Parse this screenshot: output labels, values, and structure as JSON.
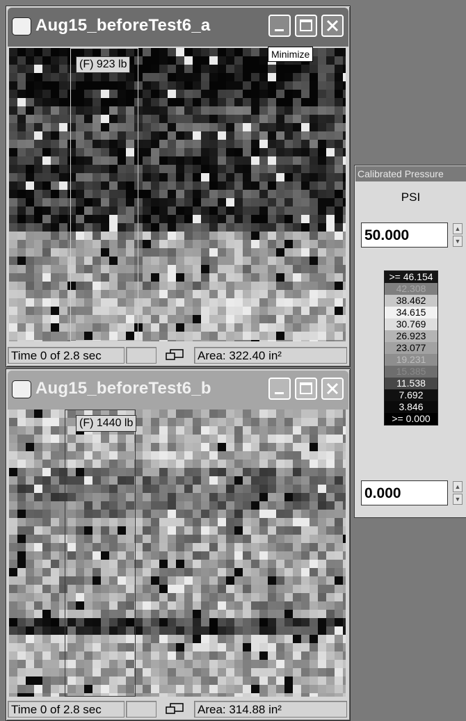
{
  "window_a": {
    "title": "Aug15_beforeTest6_a",
    "tooltip": "Minimize",
    "force_label": "(F) 923 lb",
    "status": {
      "time": "Time 0 of 2.8 sec",
      "area": "Area: 322.40 in²"
    }
  },
  "window_b": {
    "title": "Aug15_beforeTest6_b",
    "force_label": "(F) 1440 lb",
    "status": {
      "time": "Time 0 of 2.8 sec",
      "area": "Area: 314.88 in²"
    }
  },
  "scale_panel": {
    "title": "Calibrated Pressure",
    "unit": "PSI",
    "max_value": "50.000",
    "min_value": "0.000",
    "legend": [
      {
        "label": ">= 46.154",
        "bg": "#151515",
        "fg": "#ffffff"
      },
      {
        "label": "42.308",
        "bg": "#7f7f7f",
        "fg": "#a8a8a8"
      },
      {
        "label": "38.462",
        "bg": "#c8c8c8",
        "fg": "#000000"
      },
      {
        "label": "34.615",
        "bg": "#f2f2f2",
        "fg": "#000000"
      },
      {
        "label": "30.769",
        "bg": "#dedede",
        "fg": "#000000"
      },
      {
        "label": "26.923",
        "bg": "#b4b4b4",
        "fg": "#000000"
      },
      {
        "label": "23.077",
        "bg": "#a2a2a2",
        "fg": "#000000"
      },
      {
        "label": "19.231",
        "bg": "#8e8e8e",
        "fg": "#bdbdbd"
      },
      {
        "label": "15.385",
        "bg": "#6e6e6e",
        "fg": "#8a8a8a"
      },
      {
        "label": "11.538",
        "bg": "#474747",
        "fg": "#ffffff"
      },
      {
        "label": "7.692",
        "bg": "#111111",
        "fg": "#ffffff"
      },
      {
        "label": "3.846",
        "bg": "#0a0a0a",
        "fg": "#ffffff"
      },
      {
        "label": ">= 0.000",
        "bg": "#000000",
        "fg": "#ffffff"
      }
    ]
  },
  "icons": [
    "window-logo-icon",
    "minimize-icon",
    "maximize-icon",
    "close-icon",
    "snapshot-icon",
    "spin-up-icon",
    "spin-down-icon"
  ]
}
